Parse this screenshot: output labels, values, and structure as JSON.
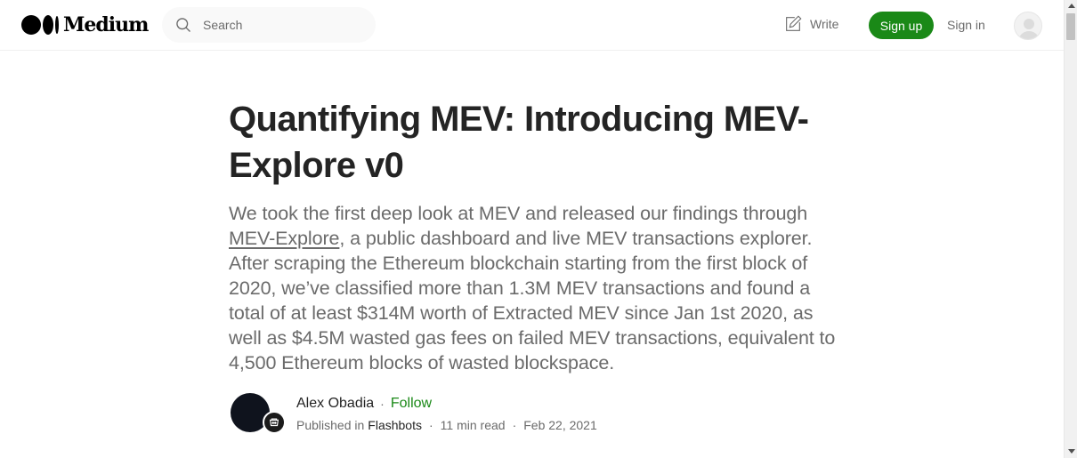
{
  "header": {
    "logo_text": "Medium",
    "search_placeholder": "Search",
    "write_label": "Write",
    "signup_label": "Sign up",
    "signin_label": "Sign in"
  },
  "article": {
    "title": "Quantifying MEV: Introducing MEV-Explore v0",
    "subtitle_link": "MEV-Explore",
    "subtitle_before": "We took the first deep look at MEV and released our findings through ",
    "subtitle_after": ", a public dashboard and live MEV transactions explorer. After scraping the Ethereum blockchain starting from the first block of 2020, we’ve classified more than 1.3M MEV transactions and found a total of at least $314M worth of Extracted MEV since Jan 1st 2020, as well as $4.5M wasted gas fees on failed MEV transactions, equivalent to 4,500 Ethereum blocks of wasted blockspace."
  },
  "byline": {
    "author": "Alex Obadia",
    "separator": "·",
    "follow_label": "Follow",
    "published_in_label": "Published in",
    "publication": "Flashbots",
    "read_time": "11 min read",
    "date": "Feb 22, 2021"
  },
  "colors": {
    "accent_green": "#1a8917",
    "text_primary": "#242424",
    "text_secondary": "#6b6b6b"
  }
}
